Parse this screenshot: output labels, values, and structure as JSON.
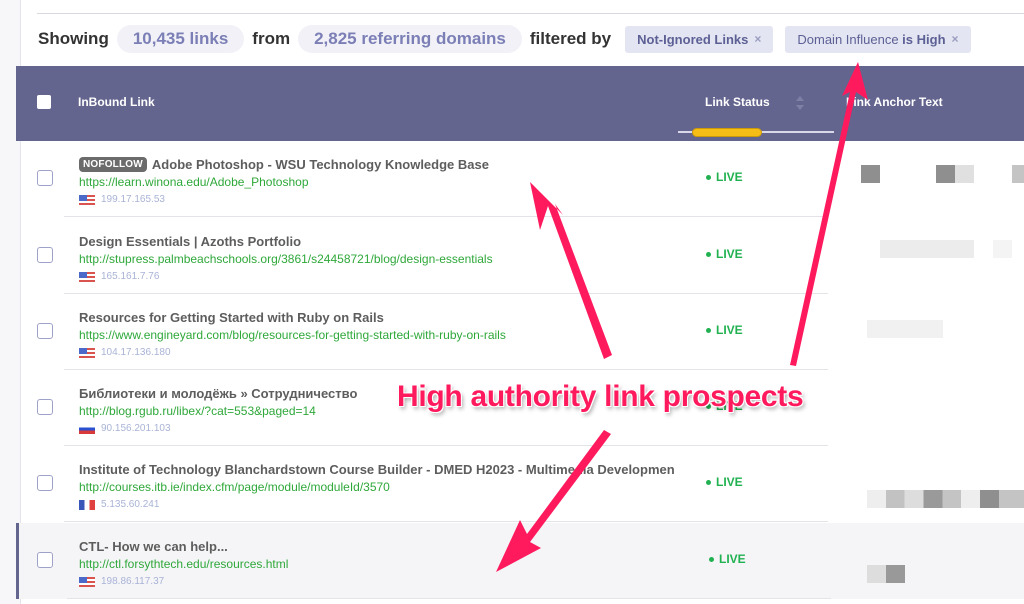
{
  "summary": {
    "showing_label": "Showing",
    "links_count": "10,435 links",
    "from_label": "from",
    "domains_count": "2,825 referring domains",
    "filtered_label": "filtered by",
    "filters": [
      {
        "label": "Not-Ignored Links",
        "remove_icon": "×"
      },
      {
        "label_prefix": "Domain Influence",
        "label_suffix": "is High",
        "remove_icon": "×"
      }
    ]
  },
  "table": {
    "columns": {
      "inbound_link": "InBound Link",
      "link_status": "Link Status",
      "anchor_text": "Link Anchor Text"
    },
    "rows": [
      {
        "badge": "NOFOLLOW",
        "title": "Adobe Photoshop - WSU Technology Knowledge Base",
        "url": "https://learn.winona.edu/Adobe_Photoshop",
        "flag": "us",
        "ip": "199.17.165.53",
        "status": "LIVE"
      },
      {
        "badge": "",
        "title": "Design Essentials | Azoths Portfolio",
        "url": "http://stupress.palmbeachschools.org/3861/s24458721/blog/design-essentials",
        "flag": "us",
        "ip": "165.161.7.76",
        "status": "LIVE"
      },
      {
        "badge": "",
        "title": "Resources for Getting Started with Ruby on Rails",
        "url": "https://www.engineyard.com/blog/resources-for-getting-started-with-ruby-on-rails",
        "flag": "us",
        "ip": "104.17.136.180",
        "status": "LIVE"
      },
      {
        "badge": "",
        "title": "Библиотеки и молодёжь » Сотрудничество",
        "url": "http://blog.rgub.ru/libex/?cat=553&paged=14",
        "flag": "ru",
        "ip": "90.156.201.103",
        "status": "LIVE"
      },
      {
        "badge": "",
        "title": "Institute of Technology Blanchardstown Course Builder - DMED H2023 - Multimedia Developmen",
        "url": "http://courses.itb.ie/index.cfm/page/module/moduleId/3570",
        "flag": "fr",
        "ip": "5.135.60.241",
        "status": "LIVE"
      },
      {
        "badge": "",
        "title": "CTL- How we can help...",
        "url": "http://ctl.forsythtech.edu/resources.html",
        "flag": "us",
        "ip": "198.86.117.37",
        "status": "LIVE"
      }
    ]
  },
  "annotation": {
    "text": "High authority link prospects",
    "color": "#ff1a5e"
  },
  "colors": {
    "header_bg": "#64658f",
    "live_green": "#21b151",
    "url_green": "#2fa83a",
    "active_sort": "#f6bd16"
  }
}
